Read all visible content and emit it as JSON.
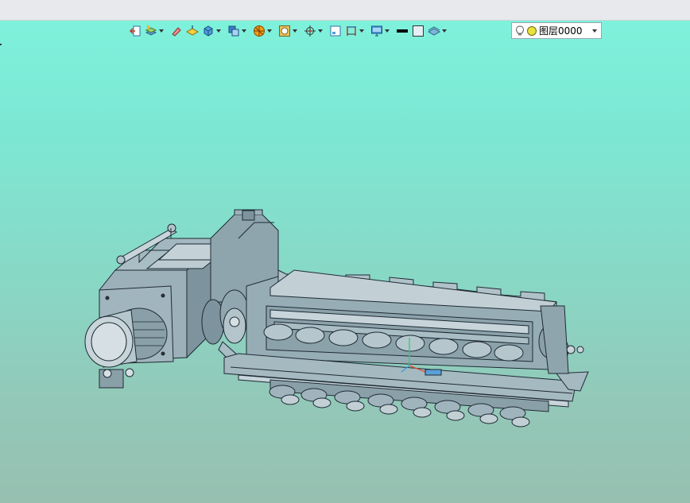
{
  "toolbar": {
    "icons": [
      {
        "name": "exit-icon",
        "dropdown": false
      },
      {
        "name": "layer-manager-icon",
        "dropdown": true
      },
      {
        "name": "eraser-icon",
        "dropdown": false
      },
      {
        "name": "sketch-plane-icon",
        "dropdown": false
      },
      {
        "name": "view-cube-icon",
        "dropdown": true
      },
      {
        "name": "display-mode-icon",
        "dropdown": true
      },
      {
        "name": "render-style-icon",
        "dropdown": true
      },
      {
        "name": "filter-icon",
        "dropdown": true
      },
      {
        "name": "snap-icon",
        "dropdown": true
      },
      {
        "name": "small-view-icon",
        "dropdown": false
      },
      {
        "name": "dimension-icon",
        "dropdown": true
      },
      {
        "name": "monitor-icon",
        "dropdown": true
      },
      {
        "name": "line-color-swatch",
        "dropdown": false
      },
      {
        "name": "fill-color-swatch",
        "dropdown": false
      },
      {
        "name": "layer-stack-icon",
        "dropdown": true
      }
    ]
  },
  "layer": {
    "value": "图层0000"
  },
  "colors": {
    "bg_top": "#7ff3dd",
    "bg_bottom": "#97c0b1",
    "model_fill": "#8fa6b0",
    "model_line": "#1e2a33"
  }
}
